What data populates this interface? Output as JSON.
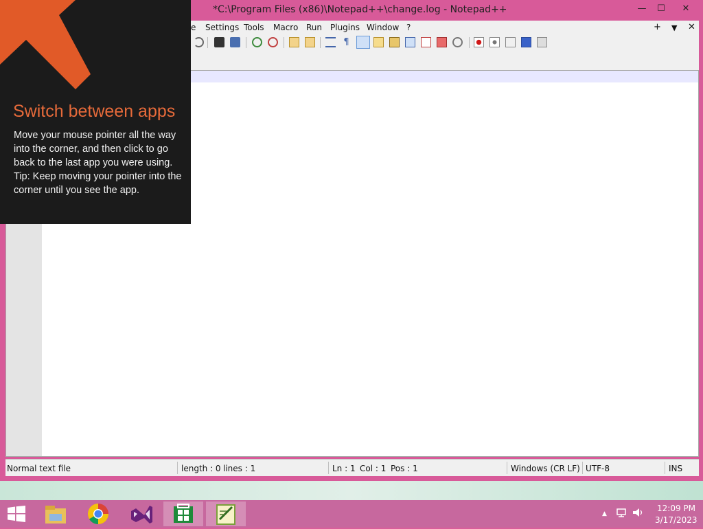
{
  "window": {
    "title": "*C:\\Program Files (x86)\\Notepad++\\change.log - Notepad++",
    "controls": {
      "minimize": "—",
      "maximize": "☐",
      "close": "✕"
    }
  },
  "menu": {
    "items": [
      "e",
      "Settings",
      "Tools",
      "Macro",
      "Run",
      "Plugins",
      "Window",
      "?"
    ],
    "right": {
      "new_tab": "+",
      "list": "▼",
      "close": "✕"
    }
  },
  "status": {
    "filetype": "Normal text file",
    "length": "length : 0",
    "lines": "lines : 1",
    "ln": "Ln : 1",
    "col": "Col : 1",
    "pos": "Pos : 1",
    "eol": "Windows (CR LF)",
    "encoding": "UTF-8",
    "mode": "INS"
  },
  "charm_tip": {
    "title": "Switch between apps",
    "body": "Move your mouse pointer all the way into the corner, and then click to go back to the last app you were using.",
    "tip": "Tip: Keep moving your pointer into the corner until you see the app."
  },
  "clock": {
    "time": "12:09 PM",
    "date": "3/17/2023"
  },
  "tray": {
    "overflow": "▲"
  },
  "colors": {
    "accent_orange": "#e66a3a",
    "frame_pink": "#d85a99",
    "taskbar": "#c7689e"
  }
}
